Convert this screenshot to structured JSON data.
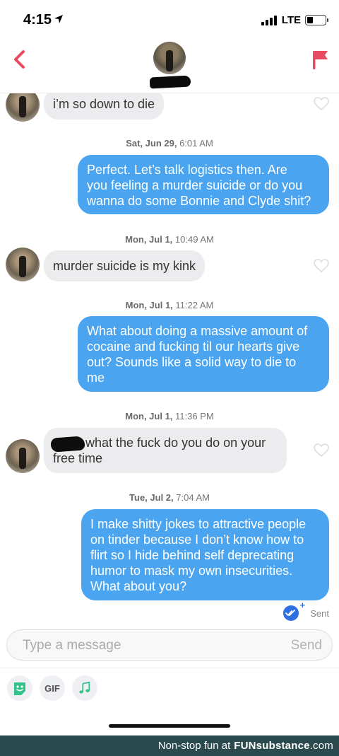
{
  "status_bar": {
    "time": "4:15",
    "network": "LTE"
  },
  "colors": {
    "accent": "#e94b63",
    "bubble_out": "#4aa4f0",
    "bubble_in": "#ececef",
    "footer_bg": "#2b4a4e"
  },
  "nav": {
    "back_icon": "chevron-left-icon",
    "report_icon": "flag-icon"
  },
  "messages": [
    {
      "type": "in",
      "text": "i’m so down to die"
    },
    {
      "type": "ts",
      "day": "Sat, Jun 29,",
      "time": "6:01 AM"
    },
    {
      "type": "out",
      "lines": [
        "Perfect. Let’s talk logistics then. Are",
        "you feeling a murder suicide or do you",
        "wanna do some Bonnie and Clyde shit?"
      ]
    },
    {
      "type": "ts",
      "day": "Mon, Jul 1,",
      "time": "10:49 AM"
    },
    {
      "type": "in",
      "text": "murder suicide is my kink"
    },
    {
      "type": "ts",
      "day": "Mon, Jul 1,",
      "time": "11:22 AM"
    },
    {
      "type": "out",
      "lines": [
        "What about doing a massive amount of",
        "cocaine and fucking til our hearts give",
        "out? Sounds like a solid way to die to",
        "me"
      ]
    },
    {
      "type": "ts",
      "day": "Mon, Jul 1,",
      "time": "11:36 PM"
    },
    {
      "type": "in",
      "lines": [
        "what the fuck do you do on your",
        "free time"
      ]
    },
    {
      "type": "ts",
      "day": "Tue, Jul 2,",
      "time": "7:04 AM"
    },
    {
      "type": "out",
      "lines": [
        "I make shitty jokes to attractive people",
        "on tinder because I don’t know how to",
        "flirt so I hide behind self deprecating",
        "humor to mask my own insecurities.",
        "What about you?"
      ]
    }
  ],
  "sent_status": "Sent",
  "composer": {
    "placeholder": "Type a message",
    "send_label": "Send"
  },
  "tools": {
    "gif_label": "GIF"
  },
  "footer": {
    "prefix": "Non-stop fun at",
    "brand": "FUNsubstance",
    "suffix": ".com"
  }
}
